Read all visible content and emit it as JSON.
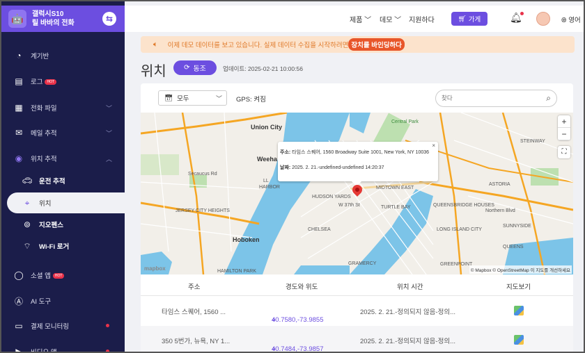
{
  "device": {
    "name": "갤럭시S10",
    "owner": "릴 바바의 전화"
  },
  "sidebar": {
    "items": [
      {
        "label": "계기반",
        "icon": "dashboard-icon"
      },
      {
        "label": "로그",
        "icon": "log-icon",
        "badge": "HOT"
      },
      {
        "label": "전화 파일",
        "icon": "phone-file-icon"
      },
      {
        "label": "메일 추적",
        "icon": "mail-icon"
      },
      {
        "label": "위치 추적",
        "icon": "location-icon"
      },
      {
        "label": "운전 추적",
        "icon": "car-icon"
      },
      {
        "label": "위치",
        "icon": "pin-icon"
      },
      {
        "label": "지오펜스",
        "icon": "geofence-icon"
      },
      {
        "label": "Wi-Fi 로거",
        "icon": "wifi-icon"
      },
      {
        "label": "소셜 앱",
        "icon": "chat-icon",
        "badge": "HOT"
      },
      {
        "label": "AI 도구",
        "icon": "ai-icon"
      },
      {
        "label": "결제 모니터링",
        "icon": "payment-icon"
      },
      {
        "label": "비디오 앱",
        "icon": "video-icon"
      }
    ]
  },
  "topbar": {
    "products": "제품",
    "demo": "데모",
    "support": "지원하다",
    "buy": "가게",
    "language": "영어"
  },
  "notice": {
    "text": "이제 데모 데이터를 보고 있습니다. 실제 데이터 수집을 시작하려면",
    "link": "장치를 바인딩하다"
  },
  "page": {
    "title": "위치",
    "sync": "동조",
    "updated": "업데이트: 2025-02-21 10:00:56"
  },
  "filter": {
    "period": "모두",
    "gps": "GPS: 켜짐",
    "search_placeholder": "찾다"
  },
  "map": {
    "popup_address_label": "주소:",
    "popup_address": "타임스 스퀘어, 1560 Broadway Suite 1001, New York, NY 10036",
    "popup_date_label": "날짜:",
    "popup_date": "2025. 2. 21.-undefined-undefined 14:20:37",
    "attribution": "© Mapbox © OpenStreetMap 이 지도를 개선하세요",
    "logo": "mapbox",
    "labels": {
      "union_city": "Union City",
      "weehawken": "Weeha",
      "hoboken": "Hoboken",
      "central_park": "Central Park",
      "midtown_east": "MIDTOWN EAST",
      "w37": "W 37th St",
      "chelsea": "CHELSEA",
      "hudson_yards": "HUDSON YARDS",
      "turtle_bay": "TURTLE BAY",
      "long_island_city": "LONG ISLAND CITY",
      "northern_blvd": "Northern Blvd",
      "sunnyside": "SUNNYSIDE",
      "steinway": "STEINWAY",
      "astoria": "ASTORIA",
      "gramercy": "GRAMERCY",
      "jersey_city_heights": "JERSEY CITY HEIGHTS",
      "hamilton_park": "HAMILTON PARK",
      "greenpoint": "GREENPOINT",
      "queensbridge": "QUEENSBRIDGE HOUSES",
      "secaucus": "Secaucus Rd",
      "ll": "LL",
      "harbor": "HARBOR",
      "queens": "QUEENS"
    }
  },
  "table": {
    "headers": [
      "주소",
      "경도와 위도",
      "위치 시간",
      "지도보기"
    ],
    "rows": [
      {
        "address": "타임스 스퀘어, 1560 ...",
        "coords": "40.7580,-73.9855",
        "time": "2025. 2. 21.-정의되지 않음-정의..."
      },
      {
        "address": "350 5번가, 뉴욕, NY 1...",
        "coords": "40.7484,-73.9857",
        "time": "2025. 2. 21.-정의되지 않음-정의..."
      }
    ]
  },
  "colors": {
    "accent": "#6c4ee0",
    "sidebar": "#1b1d4a",
    "notice_bg": "#fce3cc",
    "alert": "#e8562a"
  }
}
